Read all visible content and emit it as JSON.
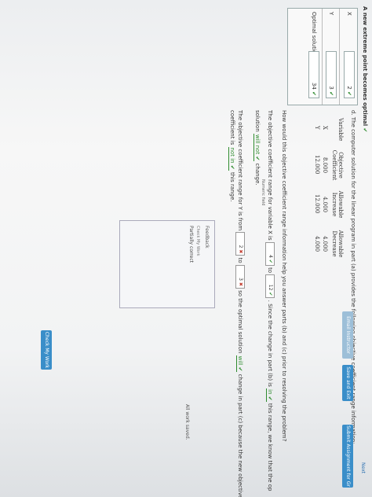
{
  "heading": "A new extreme point becomes optimal",
  "table": {
    "rows": [
      {
        "label": "X",
        "value": "2"
      },
      {
        "label": "Y",
        "value": "3"
      },
      {
        "label": "Optimal solution",
        "value": "34"
      }
    ]
  },
  "part_d": {
    "prompt": "d.  The computer solution for the linear program in part (a) provides the following objective coefficient range information:",
    "headers": {
      "variable": "Variable",
      "objective": "Objective Coefficient",
      "increase": "Allowable Increase",
      "decrease": "Allowable Decrease"
    },
    "rows": [
      {
        "variable": "X",
        "objective": "8.000",
        "increase": "4.000",
        "decrease": "4.000"
      },
      {
        "variable": "Y",
        "objective": "12.000",
        "increase": "12.000",
        "decrease": "4.000"
      }
    ],
    "question": "How would this objective coefficient range information help you answer parts (b) and (c) prior to resolving the problem?",
    "line1_a": "The objective coefficient range for variable X is",
    "x_low": "4",
    "to": "to",
    "x_high": "12",
    "line1_b": ". Since the change in part (b) is",
    "in_select": "in",
    "line1_c": "this range, we know that the op",
    "line2_a": "solution",
    "will_not": "will not",
    "line2_b": "change.",
    "numeric_field": "Numeric field",
    "line3_a": "The objective coefficient range for Y is from",
    "y_low": "2",
    "y_high": "3",
    "line3_b": "so the optimal solution",
    "will": "will",
    "line3_c": "change in part (c) because the new objective",
    "line4_a": "coefficient is",
    "not_in": "not in",
    "line4_b": "this range."
  },
  "feedback": {
    "title": "Feedback",
    "check_label": "Check My Work",
    "status": "Partially correct"
  },
  "buttons": {
    "check_my_work": "Check My Work",
    "email_instructor": "Email Instructor",
    "save_and_exit": "Save and Exit",
    "submit": "Submit Assignment for Gr",
    "next": "Next"
  },
  "status": "All work saved."
}
